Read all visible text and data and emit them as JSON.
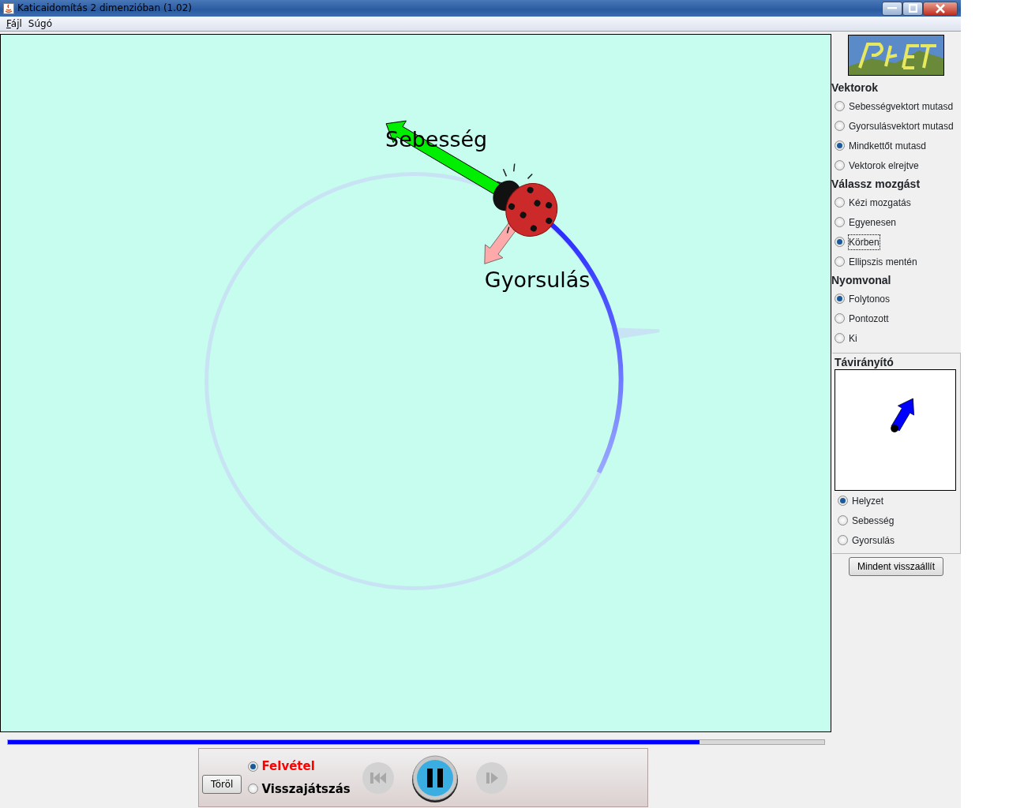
{
  "window": {
    "title": "Katicaidomítás 2 dimenzióban (1.02)"
  },
  "menu": [
    {
      "label": "Fájl",
      "mnemonic": true
    },
    {
      "label": "Súgó",
      "mnemonic": false
    }
  ],
  "canvas": {
    "velocity_label": "Sebesség",
    "acceleration_label": "Gyorsulás"
  },
  "side_panel": {
    "groups": [
      {
        "title": "Vektorok",
        "options": [
          {
            "label": "Sebességvektort mutasd",
            "selected": false,
            "focused": false
          },
          {
            "label": "Gyorsulásvektort mutasd",
            "selected": false,
            "focused": false
          },
          {
            "label": "Mindkettőt mutasd",
            "selected": true,
            "focused": false
          },
          {
            "label": "Vektorok elrejtve",
            "selected": false,
            "focused": false
          }
        ]
      },
      {
        "title": "Válassz mozgást",
        "options": [
          {
            "label": "Kézi mozgatás",
            "selected": false,
            "focused": false
          },
          {
            "label": "Egyenesen",
            "selected": false,
            "focused": false
          },
          {
            "label": "Körben",
            "selected": true,
            "focused": true
          },
          {
            "label": "Ellipszis mentén",
            "selected": false,
            "focused": false
          }
        ]
      },
      {
        "title": "Nyomvonal",
        "options": [
          {
            "label": "Folytonos",
            "selected": true,
            "focused": false
          },
          {
            "label": "Pontozott",
            "selected": false,
            "focused": false
          },
          {
            "label": "Ki",
            "selected": false,
            "focused": false
          }
        ]
      }
    ],
    "remote": {
      "title": "Távirányító",
      "options": [
        {
          "label": "Helyzet",
          "selected": true
        },
        {
          "label": "Sebesség",
          "selected": false
        },
        {
          "label": "Gyorsulás",
          "selected": false
        }
      ]
    },
    "reset_button": "Mindent visszaállít"
  },
  "timeline": {
    "level": 0.847
  },
  "playback": {
    "clear_button": "Töröl",
    "modes": [
      {
        "label": "Felvétel",
        "selected": true,
        "color": "#ff0000"
      },
      {
        "label": "Visszajátszás",
        "selected": false,
        "color": "#000000"
      }
    ],
    "controls": [
      {
        "kind": "rewind",
        "disabled": true
      },
      {
        "kind": "pause",
        "disabled": false
      },
      {
        "kind": "step",
        "disabled": true
      }
    ]
  }
}
